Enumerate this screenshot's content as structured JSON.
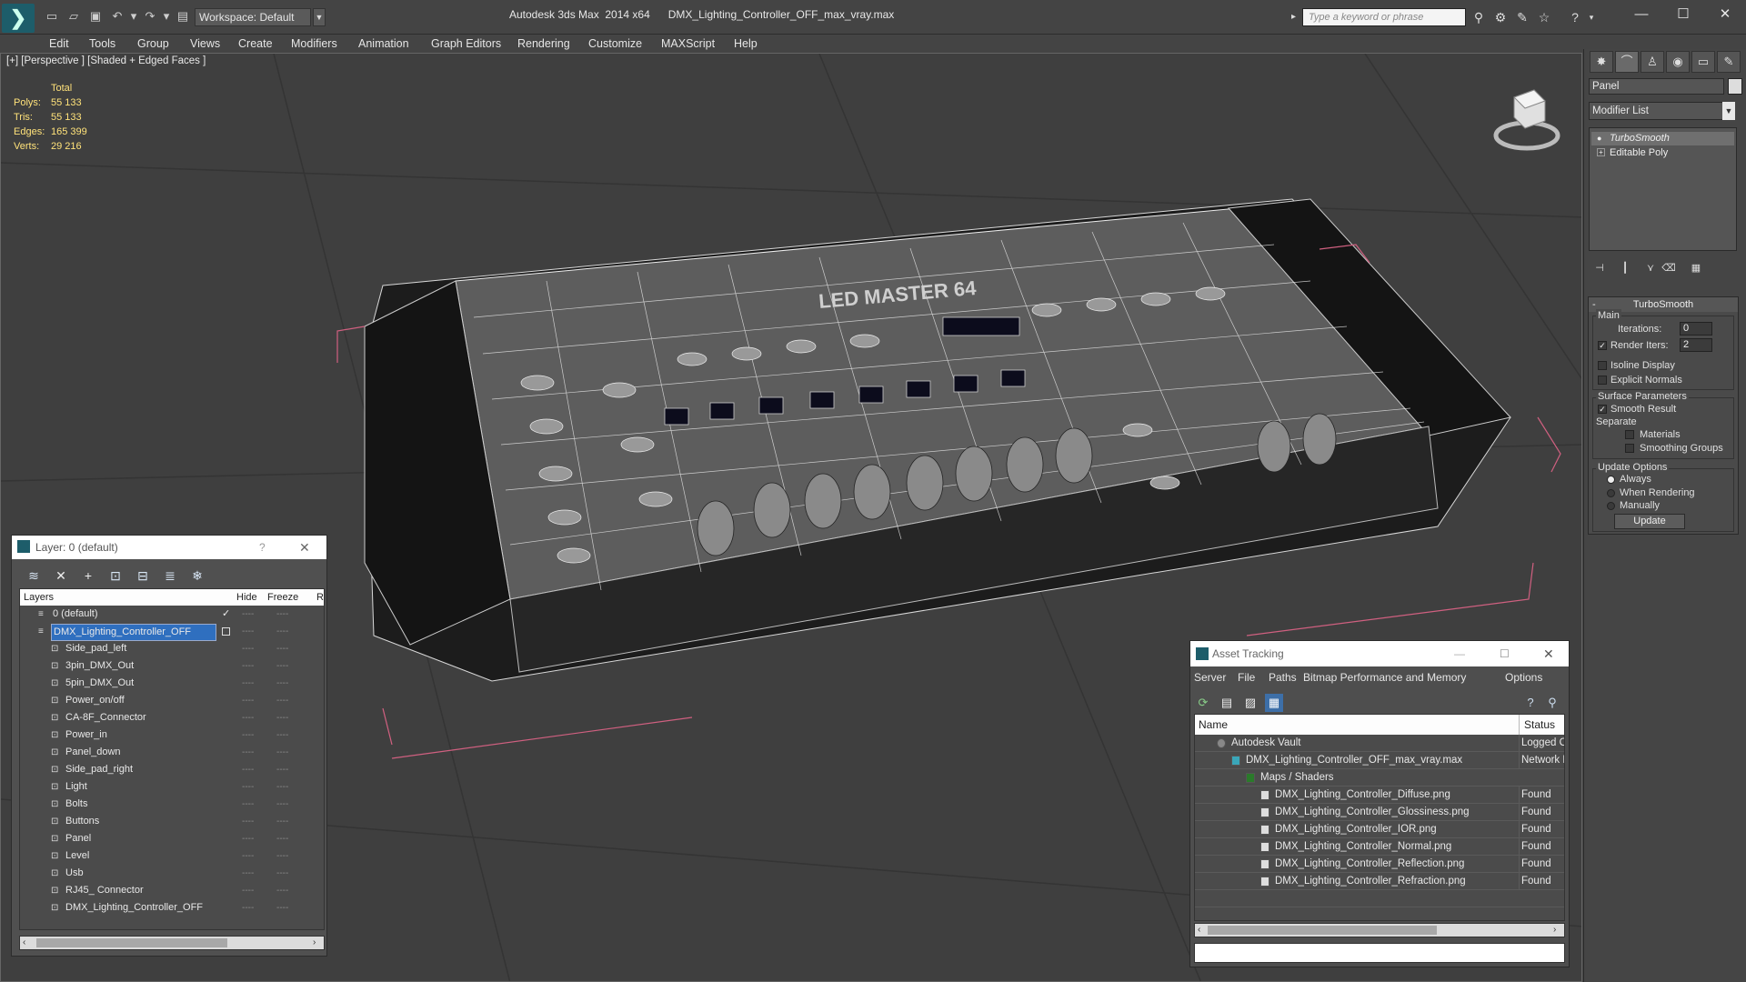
{
  "titlebar": {
    "workspace": "Workspace: Default",
    "title": "Autodesk 3ds Max  2014 x64      DMX_Lighting_Controller_OFF_max_vray.max",
    "search_placeholder": "Type a keyword or phrase",
    "minimize": "—",
    "maximize": "☐",
    "close": "✕"
  },
  "menu": [
    "Edit",
    "Tools",
    "Group",
    "Views",
    "Create",
    "Modifiers",
    "Animation",
    "Graph Editors",
    "Rendering",
    "Customize",
    "MAXScript",
    "Help"
  ],
  "viewport": {
    "label": "[+] [Perspective ] [Shaded + Edged Faces ]",
    "stats": {
      "header": "Total",
      "rows": [
        {
          "label": "Polys:",
          "value": "55 133"
        },
        {
          "label": "Tris:",
          "value": "55 133"
        },
        {
          "label": "Edges:",
          "value": "165 399"
        },
        {
          "label": "Verts:",
          "value": "29 216"
        }
      ]
    },
    "model_text": "LED MASTER 64"
  },
  "command_panel": {
    "object_name": "Panel",
    "modifier_list": "Modifier List",
    "stack": [
      "TurboSmooth",
      "Editable Poly"
    ],
    "rollout_title": "TurboSmooth",
    "main_label": "Main",
    "iterations_label": "Iterations:",
    "iterations_value": "0",
    "render_iters_label": "Render Iters:",
    "render_iters_value": "2",
    "render_iters_checked": "✓",
    "isoline_label": "Isoline Display",
    "explicit_normals_label": "Explicit Normals",
    "surface_params_label": "Surface Parameters",
    "smooth_result_label": "Smooth Result",
    "smooth_result_checked": "✓",
    "separate_label": "Separate",
    "materials_label": "Materials",
    "smoothing_groups_label": "Smoothing Groups",
    "update_options_label": "Update Options",
    "always_label": "Always",
    "when_rendering_label": "When Rendering",
    "manually_label": "Manually",
    "update_button": "Update"
  },
  "layer_dialog": {
    "title": "Layer: 0 (default)",
    "help": "?",
    "close": "✕",
    "columns": {
      "layers": "Layers",
      "hide": "Hide",
      "freeze": "Freeze",
      "render": "R"
    },
    "rows": [
      {
        "name": "0 (default)",
        "level": 0,
        "check": "✓"
      },
      {
        "name": "DMX_Lighting_Controller_OFF",
        "level": 0,
        "selected": true
      },
      {
        "name": "Side_pad_left",
        "level": 1
      },
      {
        "name": "3pin_DMX_Out",
        "level": 1
      },
      {
        "name": "5pin_DMX_Out",
        "level": 1
      },
      {
        "name": "Power_on/off",
        "level": 1
      },
      {
        "name": "CA-8F_Connector",
        "level": 1
      },
      {
        "name": "Power_in",
        "level": 1
      },
      {
        "name": "Panel_down",
        "level": 1
      },
      {
        "name": "Side_pad_right",
        "level": 1
      },
      {
        "name": "Light",
        "level": 1
      },
      {
        "name": "Bolts",
        "level": 1
      },
      {
        "name": "Buttons",
        "level": 1
      },
      {
        "name": "Panel",
        "level": 1
      },
      {
        "name": "Level",
        "level": 1
      },
      {
        "name": "Usb",
        "level": 1
      },
      {
        "name": "RJ45_ Connector",
        "level": 1
      },
      {
        "name": "DMX_Lighting_Controller_OFF",
        "level": 1
      }
    ],
    "dash": "----"
  },
  "asset_tracking": {
    "title": "Asset Tracking",
    "menu": [
      "Server",
      "File",
      "Paths",
      "Bitmap Performance and Memory",
      "Options"
    ],
    "columns": {
      "name": "Name",
      "status": "Status"
    },
    "rows": [
      {
        "name": "Autodesk Vault",
        "indent": 0,
        "status": "Logged O"
      },
      {
        "name": "DMX_Lighting_Controller_OFF_max_vray.max",
        "indent": 1,
        "status": "Network F"
      },
      {
        "name": "Maps / Shaders",
        "indent": 2,
        "status": ""
      },
      {
        "name": "DMX_Lighting_Controller_Diffuse.png",
        "indent": 3,
        "status": "Found"
      },
      {
        "name": "DMX_Lighting_Controller_Glossiness.png",
        "indent": 3,
        "status": "Found"
      },
      {
        "name": "DMX_Lighting_Controller_IOR.png",
        "indent": 3,
        "status": "Found"
      },
      {
        "name": "DMX_Lighting_Controller_Normal.png",
        "indent": 3,
        "status": "Found"
      },
      {
        "name": "DMX_Lighting_Controller_Reflection.png",
        "indent": 3,
        "status": "Found"
      },
      {
        "name": "DMX_Lighting_Controller_Refraction.png",
        "indent": 3,
        "status": "Found"
      }
    ],
    "minimize": "—",
    "maximize": "☐",
    "close": "✕"
  }
}
